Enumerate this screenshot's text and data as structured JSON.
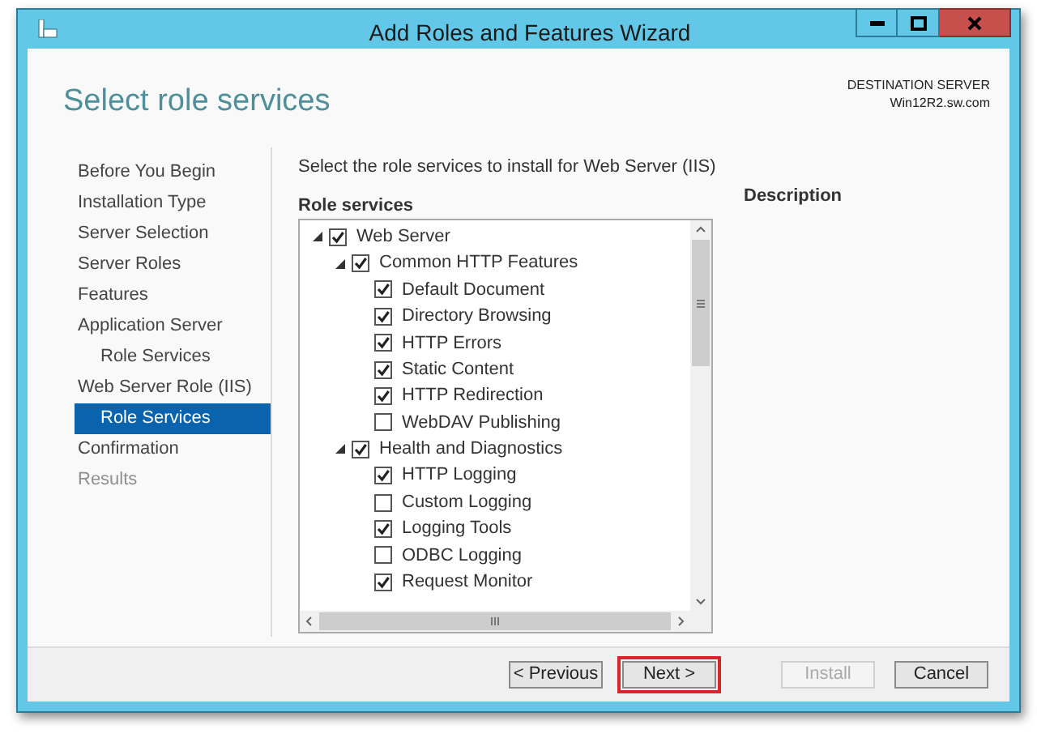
{
  "window": {
    "title": "Add Roles and Features Wizard"
  },
  "header": {
    "title": "Select role services",
    "destination_label": "DESTINATION SERVER",
    "destination_server": "Win12R2.sw.com"
  },
  "sidebar": {
    "items": [
      {
        "label": "Before You Begin",
        "selected": false,
        "disabled": false
      },
      {
        "label": "Installation Type",
        "selected": false,
        "disabled": false
      },
      {
        "label": "Server Selection",
        "selected": false,
        "disabled": false
      },
      {
        "label": "Server Roles",
        "selected": false,
        "disabled": false
      },
      {
        "label": "Features",
        "selected": false,
        "disabled": false
      },
      {
        "label": "Application Server",
        "selected": false,
        "disabled": false,
        "children": [
          {
            "label": "Role Services",
            "selected": false,
            "disabled": false
          }
        ]
      },
      {
        "label": "Web Server Role (IIS)",
        "selected": false,
        "disabled": false,
        "children": [
          {
            "label": "Role Services",
            "selected": true,
            "disabled": false
          }
        ]
      },
      {
        "label": "Confirmation",
        "selected": false,
        "disabled": false
      },
      {
        "label": "Results",
        "selected": false,
        "disabled": true
      }
    ]
  },
  "main": {
    "instruction": "Select the role services to install for Web Server (IIS)",
    "tree_heading": "Role services",
    "description_heading": "Description",
    "tree": [
      {
        "label": "Web Server",
        "checked": true,
        "expanded": true,
        "children": [
          {
            "label": "Common HTTP Features",
            "checked": true,
            "expanded": true,
            "children": [
              {
                "label": "Default Document",
                "checked": true
              },
              {
                "label": "Directory Browsing",
                "checked": true
              },
              {
                "label": "HTTP Errors",
                "checked": true
              },
              {
                "label": "Static Content",
                "checked": true
              },
              {
                "label": "HTTP Redirection",
                "checked": true
              },
              {
                "label": "WebDAV Publishing",
                "checked": false
              }
            ]
          },
          {
            "label": "Health and Diagnostics",
            "checked": true,
            "expanded": true,
            "children": [
              {
                "label": "HTTP Logging",
                "checked": true
              },
              {
                "label": "Custom Logging",
                "checked": false
              },
              {
                "label": "Logging Tools",
                "checked": true
              },
              {
                "label": "ODBC Logging",
                "checked": false
              },
              {
                "label": "Request Monitor",
                "checked": true
              }
            ]
          }
        ]
      }
    ]
  },
  "buttons": [
    {
      "label": "< Previous",
      "disabled": false,
      "highlighted": false
    },
    {
      "label": "Next >",
      "disabled": false,
      "highlighted": true
    },
    {
      "label": "Install",
      "disabled": true,
      "highlighted": false
    },
    {
      "label": "Cancel",
      "disabled": false,
      "highlighted": false
    }
  ]
}
